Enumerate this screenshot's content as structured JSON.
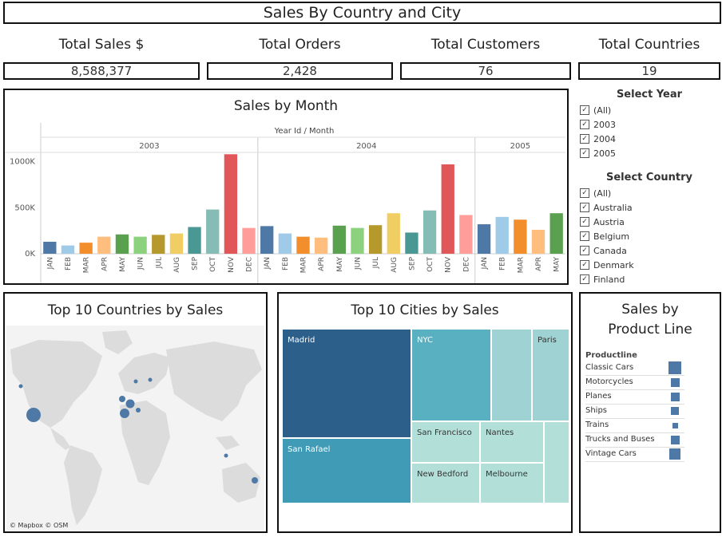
{
  "page_title": "Sales By Country and City",
  "kpis": [
    {
      "label": "Total Sales $",
      "value": "8,588,377"
    },
    {
      "label": "Total Orders",
      "value": "2,428"
    },
    {
      "label": "Total Customers",
      "value": "76"
    },
    {
      "label": "Total Countries",
      "value": "19"
    }
  ],
  "sales_by_month": {
    "title": "Sales by Month",
    "header": "Year Id / Month",
    "years": [
      "2003",
      "2004",
      "2005"
    ],
    "y_ticks": [
      "1000K",
      "500K",
      "0K"
    ]
  },
  "chart_data": {
    "type": "bar",
    "title": "Sales by Month",
    "xlabel": "Year Id / Month",
    "ylabel": "",
    "ylim": [
      0,
      1100000
    ],
    "categories": [
      "JAN",
      "FEB",
      "MAR",
      "APR",
      "MAY",
      "JUN",
      "JUL",
      "AUG",
      "SEP",
      "OCT",
      "NOV",
      "DEC",
      "JAN",
      "FEB",
      "MAR",
      "APR",
      "MAY",
      "JUN",
      "JUL",
      "AUG",
      "SEP",
      "OCT",
      "NOV",
      "DEC",
      "JAN",
      "FEB",
      "MAR",
      "APR",
      "MAY"
    ],
    "groups": [
      "2003",
      "2003",
      "2003",
      "2003",
      "2003",
      "2003",
      "2003",
      "2003",
      "2003",
      "2003",
      "2003",
      "2003",
      "2004",
      "2004",
      "2004",
      "2004",
      "2004",
      "2004",
      "2004",
      "2004",
      "2004",
      "2004",
      "2004",
      "2004",
      "2005",
      "2005",
      "2005",
      "2005",
      "2005"
    ],
    "values": [
      130000,
      90000,
      120000,
      185000,
      210000,
      185000,
      205000,
      220000,
      290000,
      480000,
      1080000,
      280000,
      300000,
      220000,
      185000,
      175000,
      305000,
      280000,
      310000,
      440000,
      230000,
      470000,
      970000,
      420000,
      320000,
      400000,
      370000,
      260000,
      440000
    ],
    "colors": [
      "#4e79a7",
      "#a0cbe8",
      "#f28e2b",
      "#ffbe7d",
      "#59a14f",
      "#8cd17d",
      "#b6992d",
      "#f1ce63",
      "#499894",
      "#86bcb6",
      "#e15759",
      "#ff9d9a",
      "#4e79a7",
      "#a0cbe8",
      "#f28e2b",
      "#ffbe7d",
      "#59a14f",
      "#8cd17d",
      "#b6992d",
      "#f1ce63",
      "#499894",
      "#86bcb6",
      "#e15759",
      "#ff9d9a",
      "#4e79a7",
      "#a0cbe8",
      "#f28e2b",
      "#ffbe7d",
      "#59a14f"
    ]
  },
  "year_filter": {
    "title": "Select Year",
    "options": [
      "(All)",
      "2003",
      "2004",
      "2005"
    ]
  },
  "country_filter": {
    "title": "Select Country",
    "options": [
      "(All)",
      "Australia",
      "Austria",
      "Belgium",
      "Canada",
      "Denmark",
      "Finland"
    ]
  },
  "countries_map": {
    "title": "Top 10 Countries by Sales",
    "attribution": "© Mapbox  © OSM",
    "point_color": "#4e79a7"
  },
  "cities_treemap": {
    "title": "Top 10 Cities by Sales",
    "cities": [
      "Madrid",
      "San Rafael",
      "NYC",
      "Paris",
      "San Francisco",
      "Nantes",
      "New Bedford",
      "Melbourne"
    ]
  },
  "product_line": {
    "title_line1": "Sales by",
    "title_line2": "Product Line",
    "header": "Productline",
    "items": [
      {
        "label": "Classic Cars",
        "share": 1.0
      },
      {
        "label": "Motorcycles",
        "share": 0.5
      },
      {
        "label": "Planes",
        "share": 0.48
      },
      {
        "label": "Ships",
        "share": 0.42
      },
      {
        "label": "Trains",
        "share": 0.2
      },
      {
        "label": "Trucks and Buses",
        "share": 0.5
      },
      {
        "label": "Vintage Cars",
        "share": 0.72
      }
    ]
  }
}
